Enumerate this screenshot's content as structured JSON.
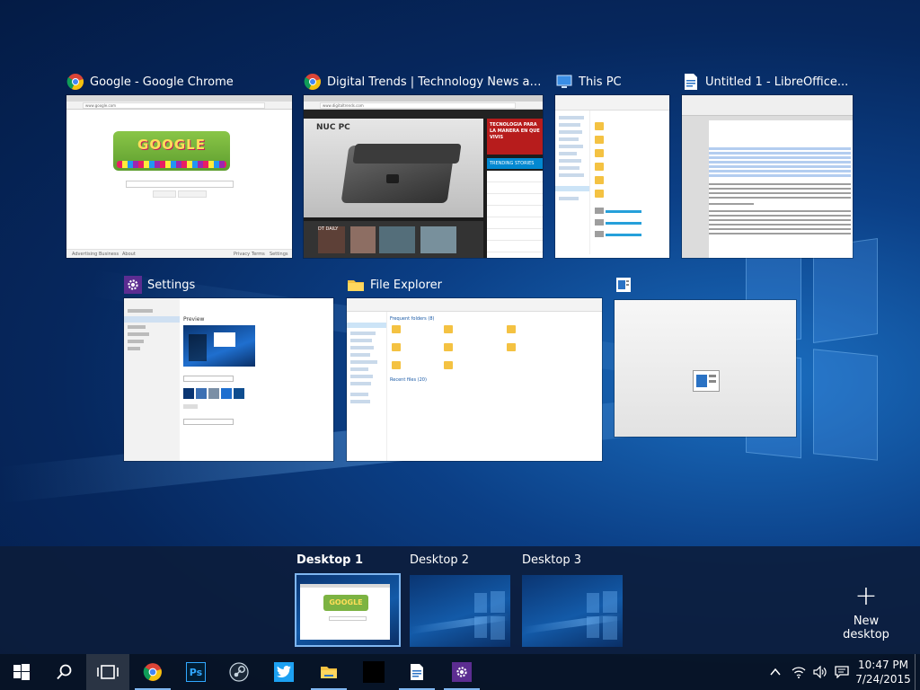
{
  "windows": [
    {
      "title": "Google - Google Chrome",
      "icon": "chrome-icon",
      "url": "www.google.com",
      "logo": "GOOGLE",
      "footer": [
        "Advertising",
        "Business",
        "About"
      ],
      "footer_right": [
        "Privacy",
        "Terms",
        "Settings"
      ]
    },
    {
      "title": "Digital Trends | Technology News and...",
      "icon": "chrome-icon",
      "url": "www.digitaltrends.com",
      "headline": "NUC PC",
      "side_heading": "TECNOLOGIA PARA LA MANERA EN QUE VIVIS",
      "section": "TRENDING STORIES",
      "tag": "DT DAILY"
    },
    {
      "title": "This PC",
      "icon": "this-pc-icon"
    },
    {
      "title": "Untitled 1 - LibreOffice...",
      "icon": "libreoffice-writer-icon"
    },
    {
      "title": "Settings",
      "icon": "settings-icon",
      "preview": "Preview"
    },
    {
      "title": "File Explorer",
      "icon": "file-explorer-icon",
      "section": "Frequent folders (8)",
      "recent": "Recent files (20)"
    },
    {
      "title": "",
      "icon": "libreoffice-start-icon"
    }
  ],
  "desktops": [
    {
      "label": "Desktop 1",
      "active": true
    },
    {
      "label": "Desktop 2",
      "active": false
    },
    {
      "label": "Desktop 3",
      "active": false
    }
  ],
  "new_desktop": {
    "label": "New desktop",
    "symbol": "+"
  },
  "taskbar": {
    "time": "10:47 PM",
    "date": "7/24/2015",
    "apps": [
      "start-icon",
      "search-icon",
      "task-view-icon",
      "chrome-icon",
      "photoshop-icon",
      "steam-icon",
      "twitter-icon",
      "file-explorer-icon",
      "black-app-icon",
      "libreoffice-writer-icon",
      "settings-icon"
    ],
    "ps_label": "Ps"
  },
  "colors": {
    "accent": "#7fb6f0",
    "settings_purple": "#5c2d91",
    "taskbar": "#08121f"
  }
}
